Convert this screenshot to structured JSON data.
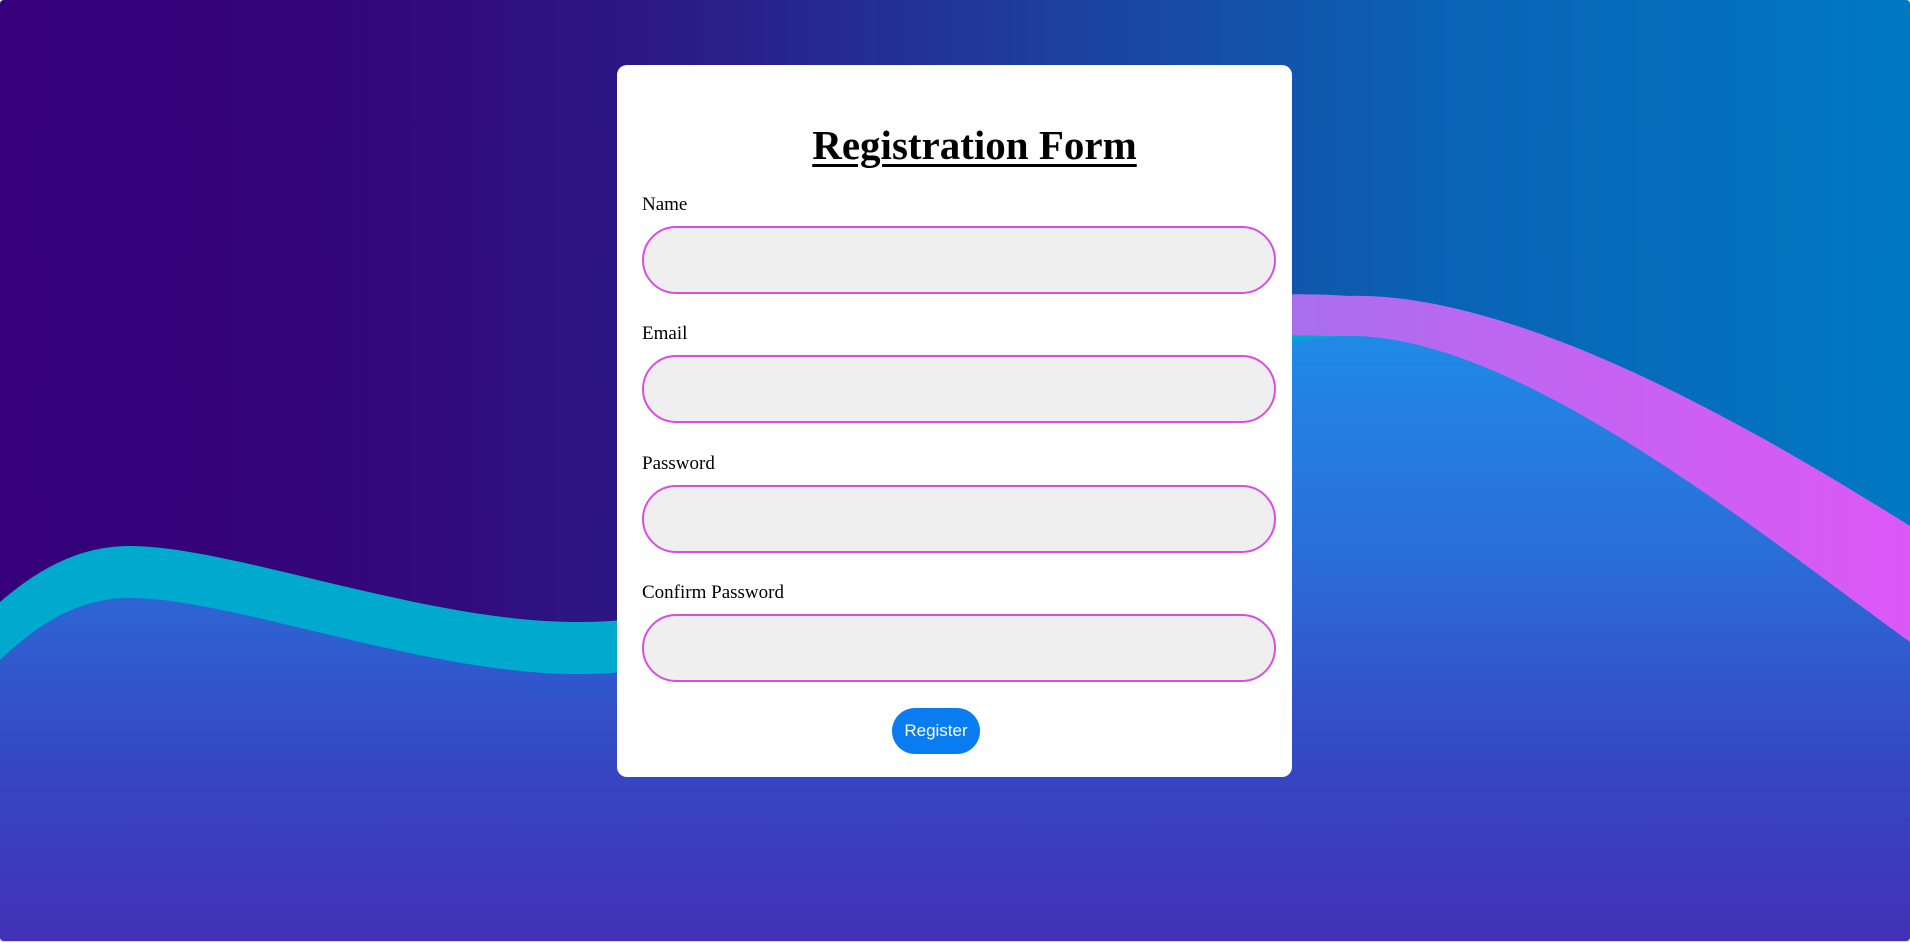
{
  "form": {
    "title": "Registration Form",
    "fields": [
      {
        "label": "Name",
        "value": "",
        "type": "text"
      },
      {
        "label": "Email",
        "value": "",
        "type": "email"
      },
      {
        "label": "Password",
        "value": "",
        "type": "password"
      },
      {
        "label": "Confirm Password",
        "value": "",
        "type": "password"
      }
    ],
    "submit_label": "Register"
  },
  "colors": {
    "background_top_left": "#35007a",
    "background_top_right": "#0079c2",
    "wave_cyan": "#00aacf",
    "wave_magenta": "#d95bf4",
    "wave_body_blue": "#1f8ae6",
    "background_bottom": "#4231b5",
    "card_background": "#ffffff",
    "input_border": "#d84fe0",
    "input_background": "#efefef",
    "button_background": "#0a7cf2",
    "button_text": "#ffffff"
  }
}
